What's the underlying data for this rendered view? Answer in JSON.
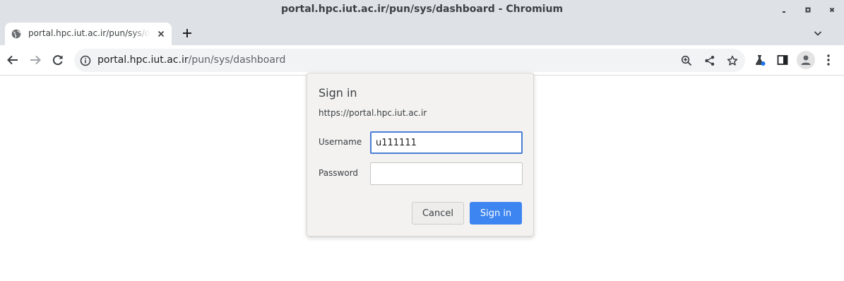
{
  "window": {
    "title": "portal.hpc.iut.ac.ir/pun/sys/dashboard - Chromium"
  },
  "tabs": [
    {
      "title": "portal.hpc.iut.ac.ir/pun/sys/dashboard",
      "favicon": "globe-icon",
      "close_icon": "close-icon"
    }
  ],
  "tabstrip": {
    "new_tab_icon": "plus-icon",
    "tab_search_icon": "chevron-down-icon"
  },
  "toolbar": {
    "back_icon": "arrow-left-icon",
    "forward_icon": "arrow-right-icon",
    "reload_icon": "reload-icon",
    "site_info_icon": "info-icon",
    "url_host": "portal.hpc.iut.ac.ir",
    "url_path": "/pun/sys/dashboard",
    "zoom_icon": "zoom-in-icon",
    "share_icon": "share-icon",
    "bookmark_icon": "star-icon",
    "extensions_icon": "flask-icon",
    "side_panel_icon": "side-panel-icon",
    "profile_icon": "avatar-icon",
    "menu_icon": "kebab-menu-icon"
  },
  "dialog": {
    "title": "Sign in",
    "origin": "https://portal.hpc.iut.ac.ir",
    "username_label": "Username",
    "username_value": "u111111",
    "password_label": "Password",
    "password_value": "",
    "cancel_label": "Cancel",
    "signin_label": "Sign in"
  },
  "colors": {
    "frame": "#dee1e6",
    "omnibox": "#f1f3f4",
    "dialog_bg": "#f3f2f1",
    "primary_button": "#3d85f0",
    "focus_ring": "#4b7fd6",
    "extension_dot": "#1a73e8"
  }
}
